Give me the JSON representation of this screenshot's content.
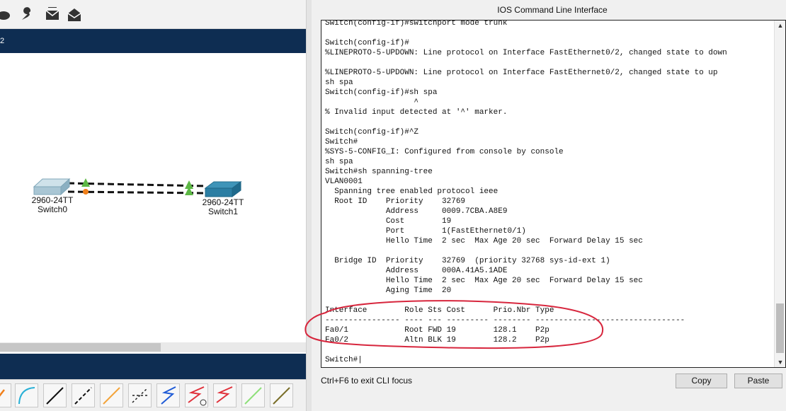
{
  "workspace": {
    "tab_fragment": "2",
    "devices": [
      {
        "model": "2960-24TT",
        "name": "Switch0"
      },
      {
        "model": "2960-24TT",
        "name": "Switch1"
      }
    ]
  },
  "toolbar_icons": [
    "shape-icon",
    "wrench-icon",
    "mail-icon",
    "open-mail-icon"
  ],
  "connection_tools": [
    "fiber-icon",
    "serial-curve-icon",
    "straight-cable-icon",
    "crossover-cable-icon",
    "console-cable-icon",
    "phone-cable-icon",
    "coaxial-cable-icon",
    "serial-dce-icon",
    "serial-dte-icon",
    "octal-cable-icon",
    "iot-cable-icon"
  ],
  "cli": {
    "title": "IOS Command Line Interface",
    "lines": [
      "Switch(config-if)#switchport mode trunk",
      "",
      "Switch(config-if)#",
      "%LINEPROTO-5-UPDOWN: Line protocol on Interface FastEthernet0/2, changed state to down",
      "",
      "%LINEPROTO-5-UPDOWN: Line protocol on Interface FastEthernet0/2, changed state to up",
      "sh spa",
      "Switch(config-if)#sh spa",
      "                   ^",
      "% Invalid input detected at '^' marker.",
      "",
      "Switch(config-if)#^Z",
      "Switch#",
      "%SYS-5-CONFIG_I: Configured from console by console",
      "sh spa",
      "Switch#sh spanning-tree",
      "VLAN0001",
      "  Spanning tree enabled protocol ieee",
      "  Root ID    Priority    32769",
      "             Address     0009.7CBA.A8E9",
      "             Cost        19",
      "             Port        1(FastEthernet0/1)",
      "             Hello Time  2 sec  Max Age 20 sec  Forward Delay 15 sec",
      "",
      "  Bridge ID  Priority    32769  (priority 32768 sys-id-ext 1)",
      "             Address     000A.41A5.1ADE",
      "             Hello Time  2 sec  Max Age 20 sec  Forward Delay 15 sec",
      "             Aging Time  20",
      "",
      "Interface        Role Sts Cost      Prio.Nbr Type",
      "---------------- ---- --- --------- -------- --------------------------------",
      "Fa0/1            Root FWD 19        128.1    P2p",
      "Fa0/2            Altn BLK 19        128.2    P2p",
      "",
      "Switch#|"
    ],
    "focus_hint": "Ctrl+F6 to exit CLI focus",
    "copy_label": "Copy",
    "paste_label": "Paste",
    "scroll_up": "▲",
    "scroll_down": "▼"
  },
  "colors": {
    "workspace_bar": "#0e2d52",
    "annotation": "#d7263d",
    "link_up": "#5db845",
    "link_blocked": "#f07f1a"
  }
}
